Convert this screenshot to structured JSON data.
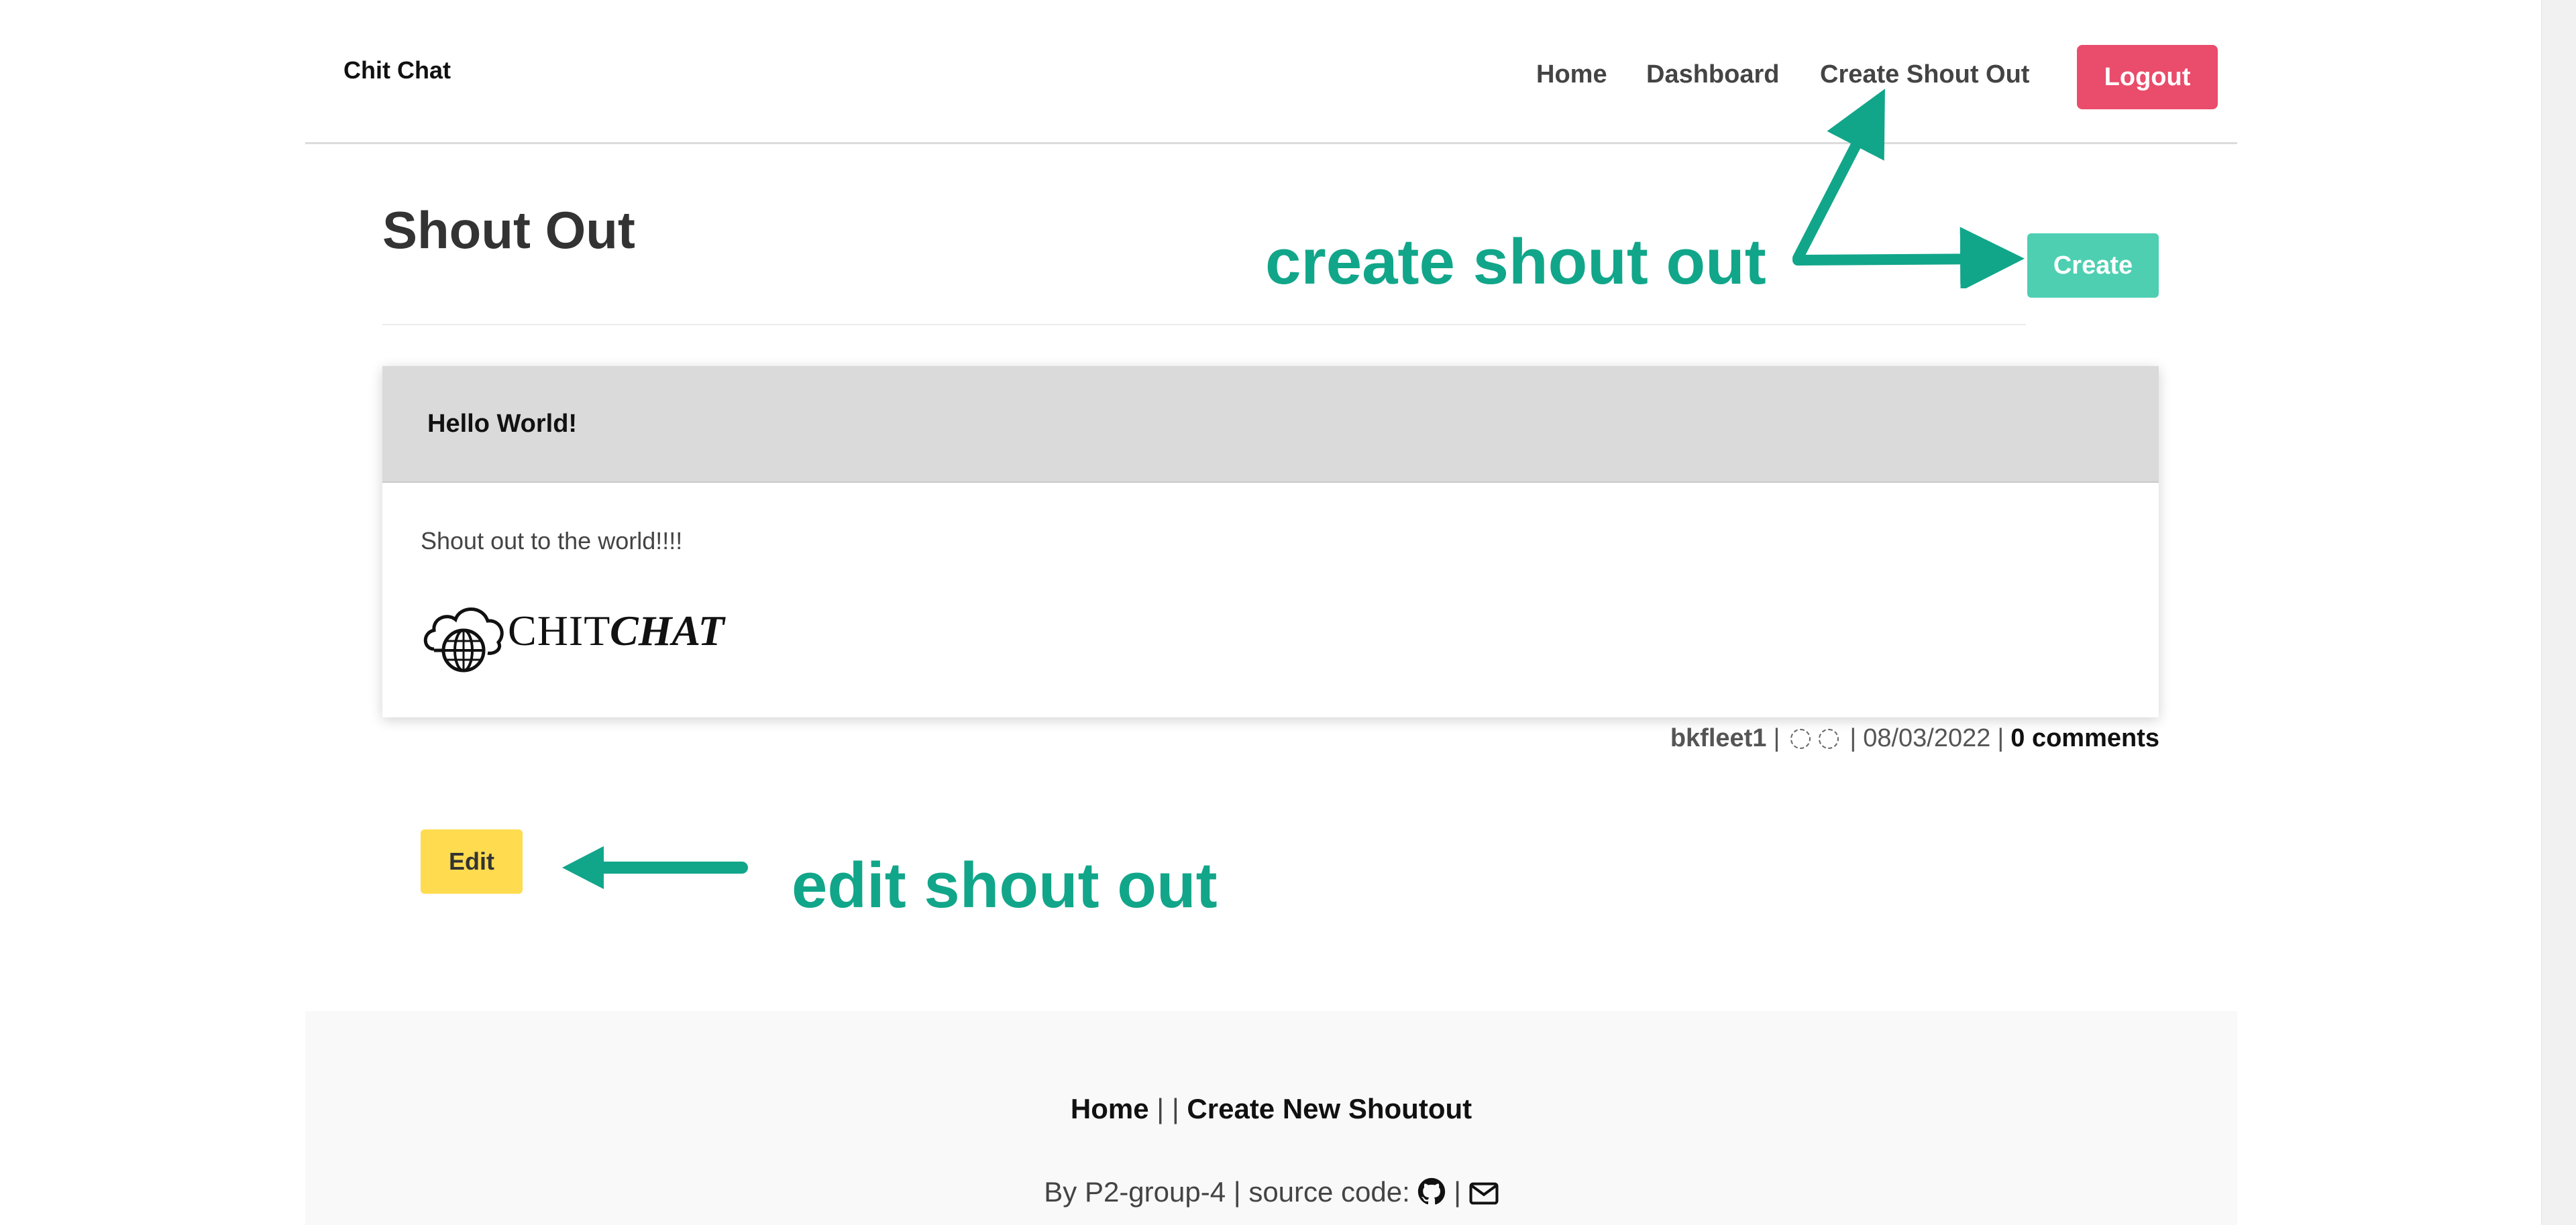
{
  "header": {
    "brand": "Chit Chat",
    "nav": [
      "Home",
      "Dashboard",
      "Create Shout Out"
    ],
    "logout": "Logout"
  },
  "page": {
    "title": "Shout Out",
    "create_button": "Create"
  },
  "annotations": {
    "create": "create shout out",
    "edit": "edit shout out",
    "arrow_color": "#11a68a"
  },
  "shoutout": {
    "title": "Hello World!",
    "body": "Shout out to the world!!!!",
    "image_logo": {
      "text_light": "CHIT",
      "text_bold": "CHAT"
    },
    "author": "bkfleet1",
    "date": "08/03/2022",
    "comments": "0 comments",
    "edit_button": "Edit"
  },
  "footer": {
    "home": "Home",
    "create_new": "Create New Shoutout",
    "credit": "By P2-group-4 | source code:"
  },
  "colors": {
    "logout": "#ea4c6b",
    "create": "#4ecfb2",
    "edit": "#ffdb4f",
    "annotation": "#11a68a"
  }
}
